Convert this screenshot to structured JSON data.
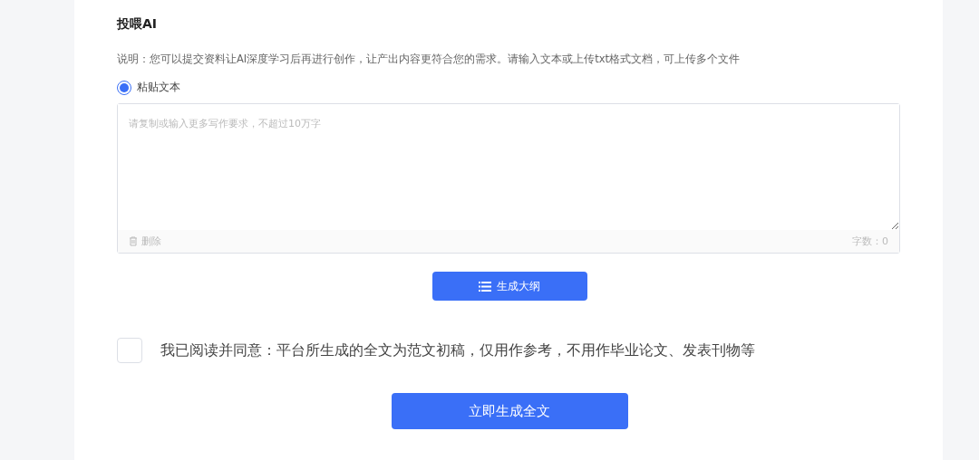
{
  "section_title": "投喂AI",
  "description": "说明：您可以提交资料让AI深度学习后再进行创作，让产出内容更符合您的需求。请输入文本或上传txt格式文档，可上传多个文件",
  "source_options": [
    {
      "label": "粘贴文本",
      "selected": true
    }
  ],
  "text_input": {
    "placeholder": "请复制或输入更多写作要求，不超过10万字",
    "delete_label": "删除",
    "char_count": "字数：0"
  },
  "outline_button": {
    "label": "生成大纲"
  },
  "agreement": {
    "checked": false,
    "text": "我已阅读并同意：平台所生成的全文为范文初稿，仅用作参考，不用作毕业论文、发表刊物等"
  },
  "submit_button": {
    "label": "立即生成全文"
  }
}
